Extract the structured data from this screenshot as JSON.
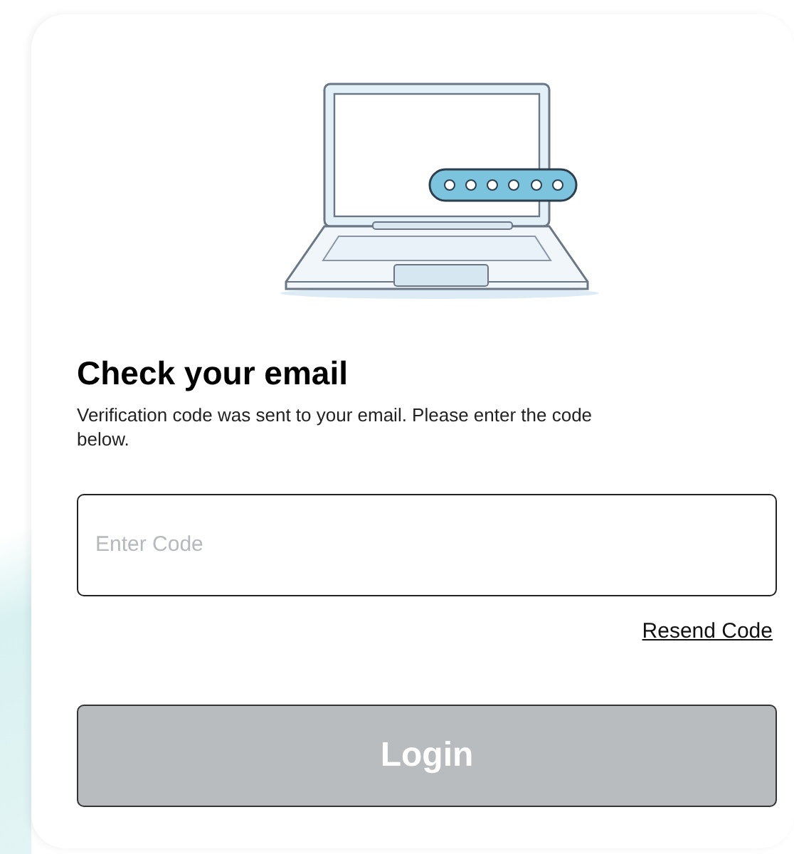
{
  "heading": "Check your email",
  "message": "Verification code was sent to your email. Please enter the code below.",
  "code_field": {
    "placeholder": "Enter Code"
  },
  "resend_link": "Resend Code",
  "login_button": {
    "label": "Login",
    "disabled": true
  }
}
